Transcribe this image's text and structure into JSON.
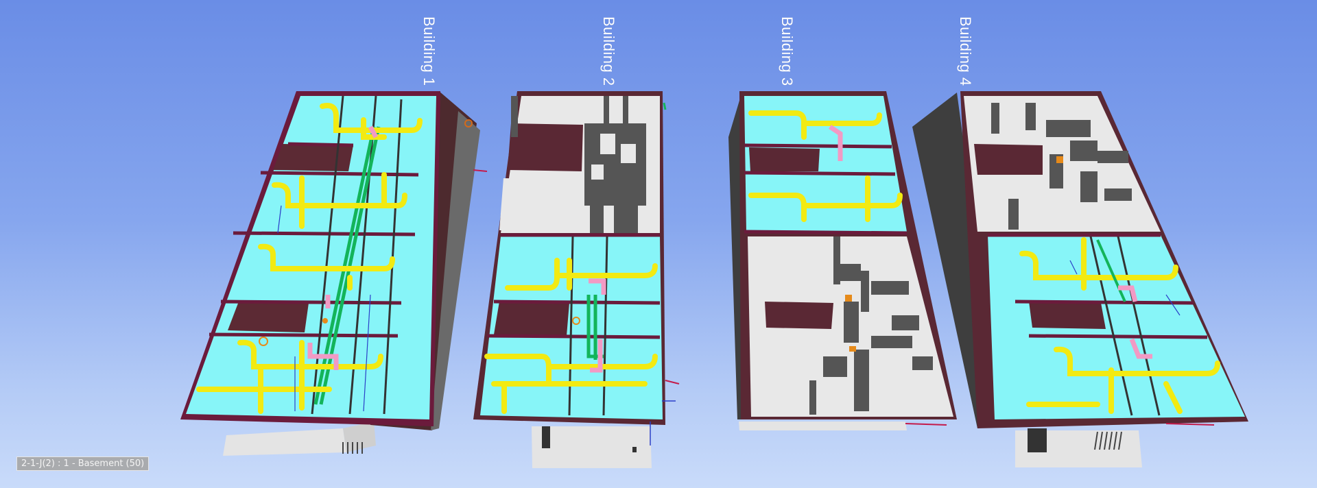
{
  "viewport": {
    "buildings": [
      {
        "label": "Building 1"
      },
      {
        "label": "Building 2"
      },
      {
        "label": "Building 3"
      },
      {
        "label": "Building 4"
      }
    ],
    "status_text": "2-1-J(2) : 1 - Basement (50)"
  },
  "colors": {
    "floor": "#87f5f8",
    "wall_top": "#6b1b3c",
    "wall_side": "#4a2a2d",
    "empty_floor": "#e8e8e8",
    "partition": "#555555",
    "duct_yellow": "#f2ea12",
    "pipe_green": "#13b45a",
    "duct_pink": "#f29ac4",
    "accent_orange": "#e68a1a"
  }
}
